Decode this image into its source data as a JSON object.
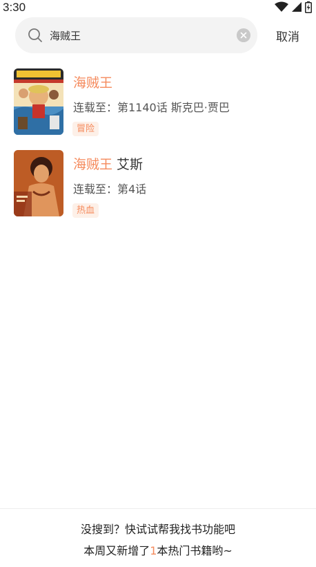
{
  "status_bar": {
    "time": "3:30",
    "icons": [
      "wifi-icon",
      "signal-icon",
      "battery-charging-icon"
    ]
  },
  "search": {
    "value": "海贼王",
    "cancel_label": "取消"
  },
  "results": [
    {
      "title_highlight": "海贼王",
      "title_rest": "",
      "meta": "连载至：第1140话 斯克巴·贾巴",
      "tag": "冒险"
    },
    {
      "title_highlight": "海贼王",
      "title_rest": " 艾斯",
      "meta": "连载至：第4话",
      "tag": "热血"
    }
  ],
  "footer": {
    "line1": "没搜到？快试试帮我找书功能吧",
    "line2_prefix": "本周又新增了",
    "line2_number": "1",
    "line2_suffix": "本热门书籍哟~"
  },
  "colors": {
    "accent": "#f58a5c",
    "tag_bg": "#fdf0e8",
    "search_bg": "#f3f3f3"
  }
}
